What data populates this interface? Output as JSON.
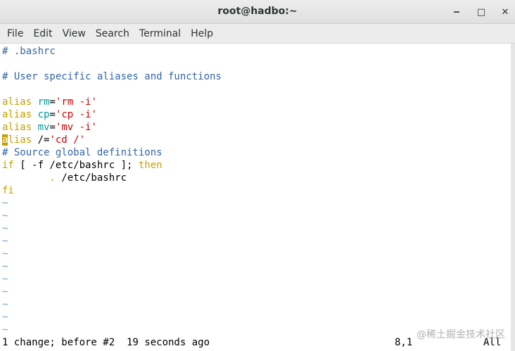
{
  "window": {
    "title": "root@hadbo:~"
  },
  "window_controls": {
    "minimize": "‒",
    "maximize": "□",
    "close": "✕"
  },
  "menu": {
    "items": [
      "File",
      "Edit",
      "View",
      "Search",
      "Terminal",
      "Help"
    ]
  },
  "editor": {
    "line1": "# .bashrc",
    "line3": "# User specific aliases and functions",
    "alias1": {
      "kw": "alias",
      "name": "rm",
      "eq": "=",
      "val": "'rm -i'"
    },
    "alias2": {
      "kw": "alias",
      "name": "cp",
      "eq": "=",
      "val": "'cp -i'"
    },
    "alias3": {
      "kw": "alias",
      "name": "mv",
      "eq": "=",
      "val": "'mv -i'"
    },
    "alias4": {
      "cursor_char": "a",
      "kw_rest": "lias",
      "name": " /=",
      "val": "'cd /'"
    },
    "comment2": "# Source global definitions",
    "if_line": {
      "kw": "if",
      "rest": " [ -f /etc/bashrc ]; ",
      "then": "then"
    },
    "source_line": {
      "dot": "        .",
      "path": " /etc/bashrc"
    },
    "fi": "fi",
    "tilde": "~"
  },
  "status_line": {
    "message": "1 change; before #2  19 seconds ago",
    "position": "8,1",
    "scroll": "All"
  },
  "watermark": "@稀土掘金技术社区"
}
